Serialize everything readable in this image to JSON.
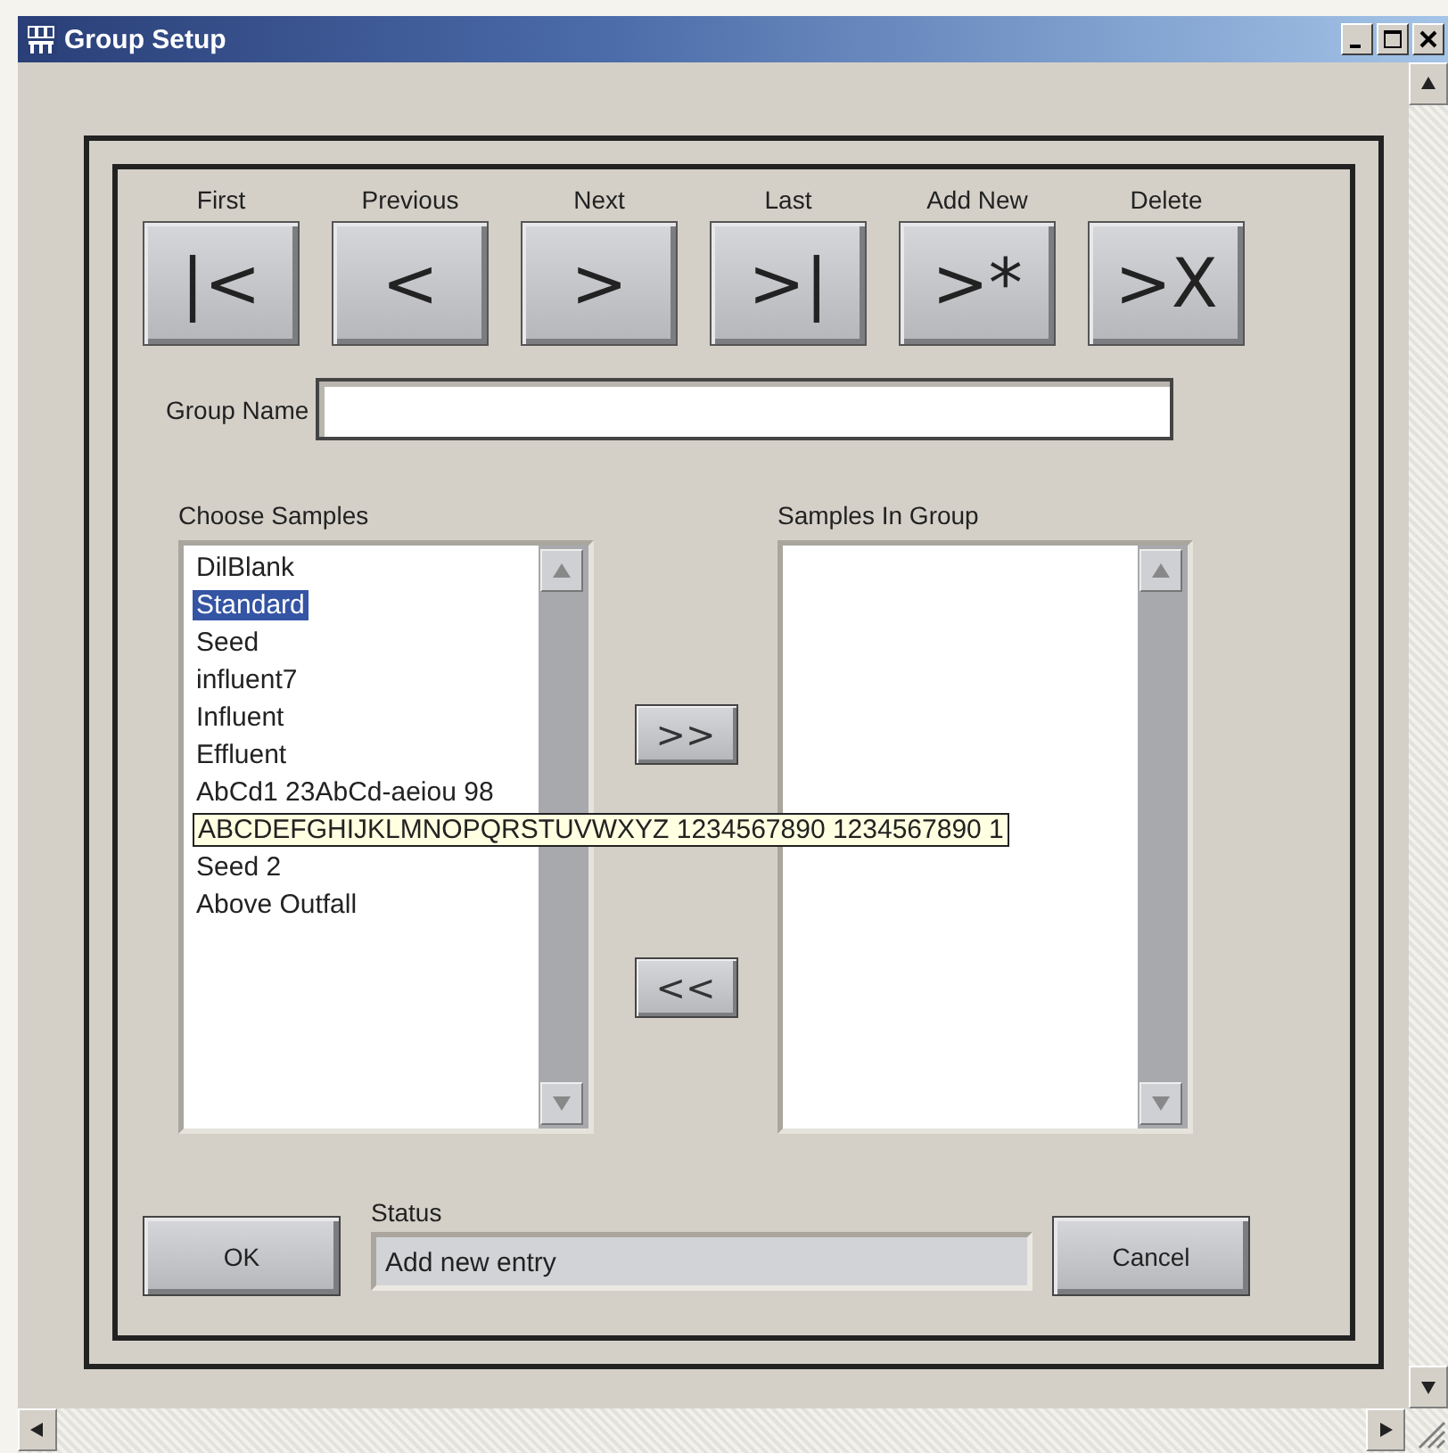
{
  "window": {
    "title": "Group Setup"
  },
  "nav_buttons": [
    {
      "label": "First",
      "symbol": "|<"
    },
    {
      "label": "Previous",
      "symbol": "<"
    },
    {
      "label": "Next",
      "symbol": ">"
    },
    {
      "label": "Last",
      "symbol": ">|"
    },
    {
      "label": "Add New",
      "symbol": ">*"
    },
    {
      "label": "Delete",
      "symbol": ">X"
    }
  ],
  "group_name": {
    "label": "Group Name"
  },
  "choose_samples": {
    "label": "Choose Samples",
    "items": [
      {
        "text": "DilBlank",
        "selected": false,
        "tooltip": false
      },
      {
        "text": "Standard",
        "selected": true,
        "tooltip": false
      },
      {
        "text": "Seed",
        "selected": false,
        "tooltip": false
      },
      {
        "text": "influent7",
        "selected": false,
        "tooltip": false
      },
      {
        "text": "Influent",
        "selected": false,
        "tooltip": false
      },
      {
        "text": "Effluent",
        "selected": false,
        "tooltip": false
      },
      {
        "text": "AbCd1 23AbCd-aeiou 98",
        "selected": false,
        "tooltip": false
      },
      {
        "text": "ABCDEFGHIJKLMNOPQRSTUVWXYZ 1234567890 1234567890 1",
        "selected": false,
        "tooltip": true
      },
      {
        "text": "Seed 2",
        "selected": false,
        "tooltip": false
      },
      {
        "text": "Above Outfall",
        "selected": false,
        "tooltip": false
      }
    ]
  },
  "samples_in_group": {
    "label": "Samples In Group"
  },
  "transfer_buttons": [
    ">>",
    "<<"
  ],
  "status": {
    "label": "Status",
    "value": "Add new entry"
  },
  "ok_button": "OK",
  "cancel_button": "Cancel"
}
